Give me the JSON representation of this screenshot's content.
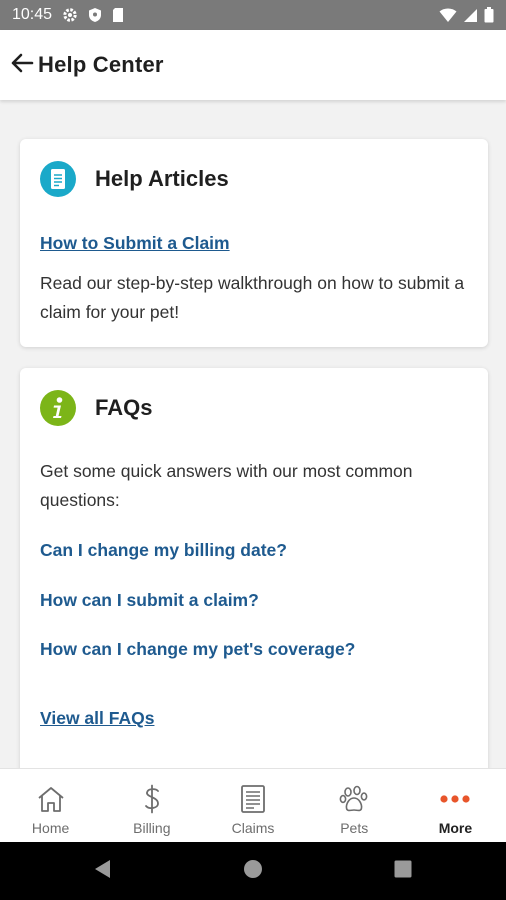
{
  "status_bar": {
    "time": "10:45"
  },
  "app_bar": {
    "title": "Help Center"
  },
  "help_articles": {
    "title": "Help Articles",
    "icon": "document-icon",
    "icon_color": "#1aa9c9",
    "link_label": "How to Submit a Claim",
    "description": "Read our step-by-step walkthrough on how to submit a claim for your pet!"
  },
  "faqs": {
    "title": "FAQs",
    "icon": "info-icon",
    "icon_color": "#7cb518",
    "intro": "Get some quick answers with our most common questions:",
    "questions": [
      "Can I change my billing date?",
      "How can I submit a claim?",
      "How can I change my pet's coverage?"
    ],
    "view_all_label": "View all FAQs"
  },
  "bottom_nav": {
    "items": [
      {
        "label": "Home",
        "icon": "home-icon"
      },
      {
        "label": "Billing",
        "icon": "dollar-icon"
      },
      {
        "label": "Claims",
        "icon": "claims-icon"
      },
      {
        "label": "Pets",
        "icon": "paw-icon"
      },
      {
        "label": "More",
        "icon": "more-icon"
      }
    ],
    "active_index": 4,
    "active_color": "#e8552b"
  },
  "colors": {
    "link": "#1e5a8f",
    "status_bar": "#7a7a7a"
  }
}
